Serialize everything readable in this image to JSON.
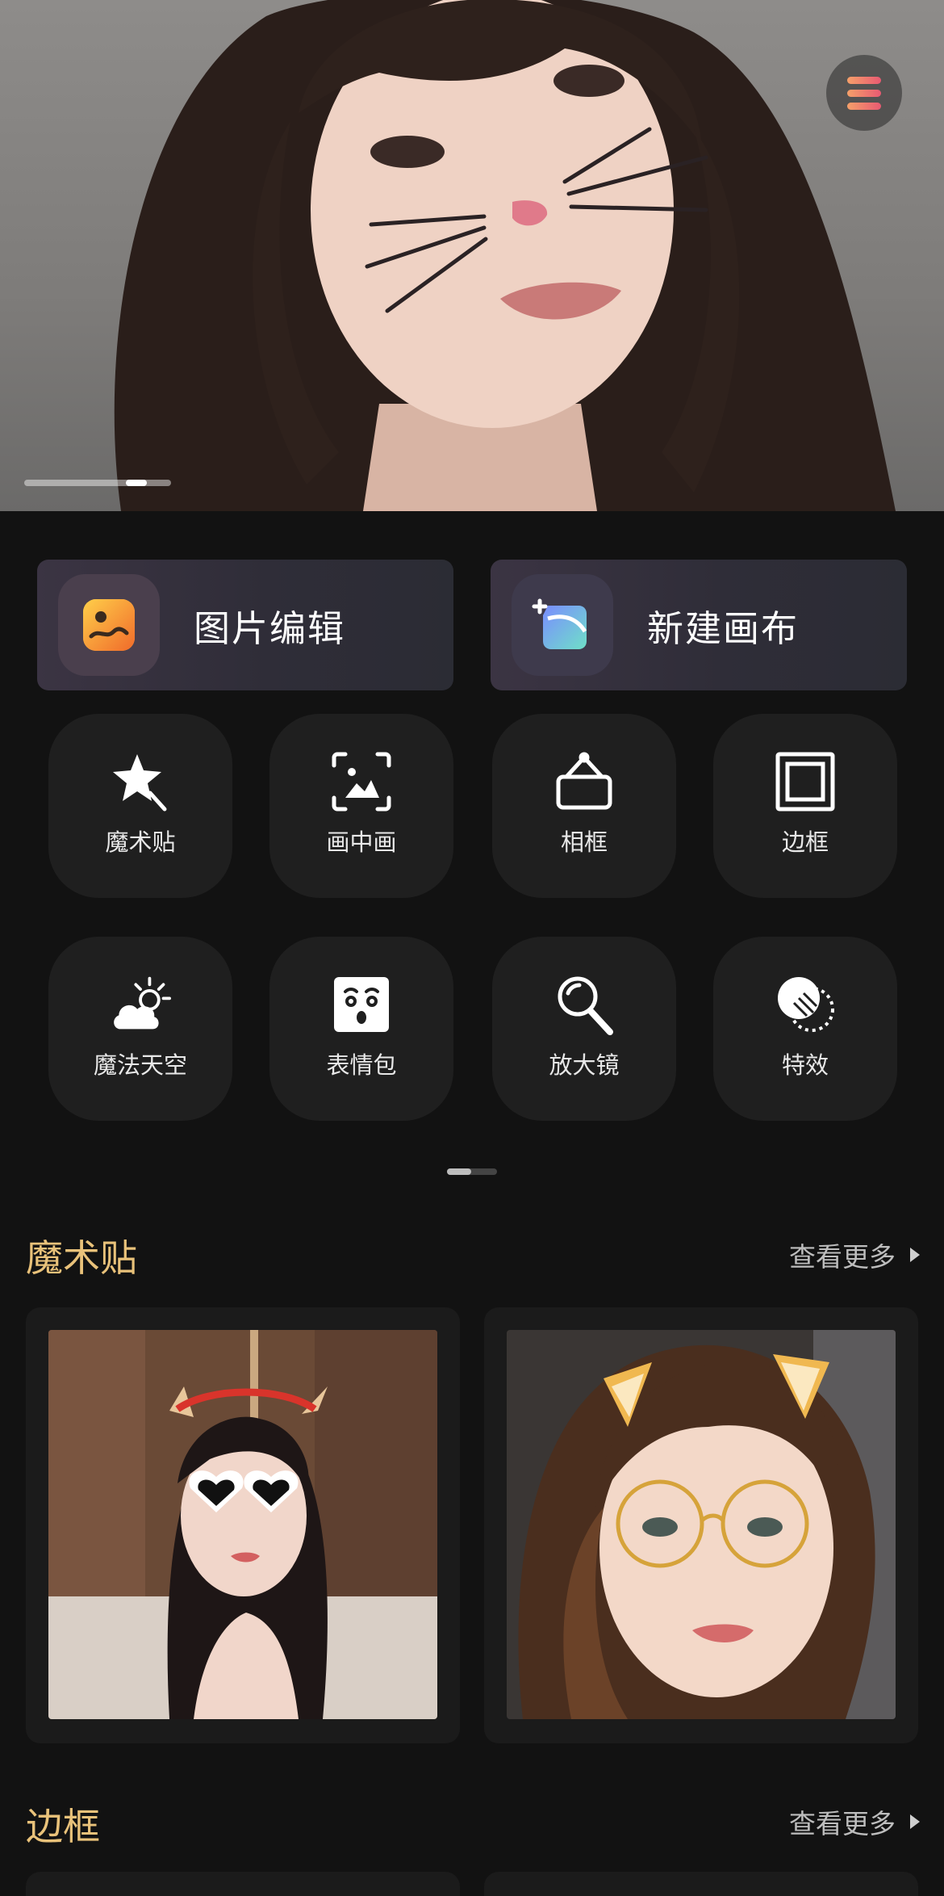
{
  "quick_actions": [
    {
      "label": "图片编辑",
      "icon": "image-edit-icon"
    },
    {
      "label": "新建画布",
      "icon": "new-canvas-icon"
    }
  ],
  "tools": [
    {
      "label": "魔术贴",
      "icon": "magic-star-icon"
    },
    {
      "label": "画中画",
      "icon": "picture-in-picture-icon"
    },
    {
      "label": "相框",
      "icon": "hanging-frame-icon"
    },
    {
      "label": "边框",
      "icon": "border-icon"
    },
    {
      "label": "魔法天空",
      "icon": "weather-sky-icon"
    },
    {
      "label": "表情包",
      "icon": "meme-face-icon"
    },
    {
      "label": "放大镜",
      "icon": "magnifier-icon"
    },
    {
      "label": "特效",
      "icon": "effects-icon"
    }
  ],
  "sections": [
    {
      "title": "魔术贴",
      "more": "查看更多"
    },
    {
      "title": "边框",
      "more": "查看更多"
    }
  ],
  "colors": {
    "accent_title": "#e9c27a",
    "background": "#121212",
    "card": "#1f1f1f"
  }
}
